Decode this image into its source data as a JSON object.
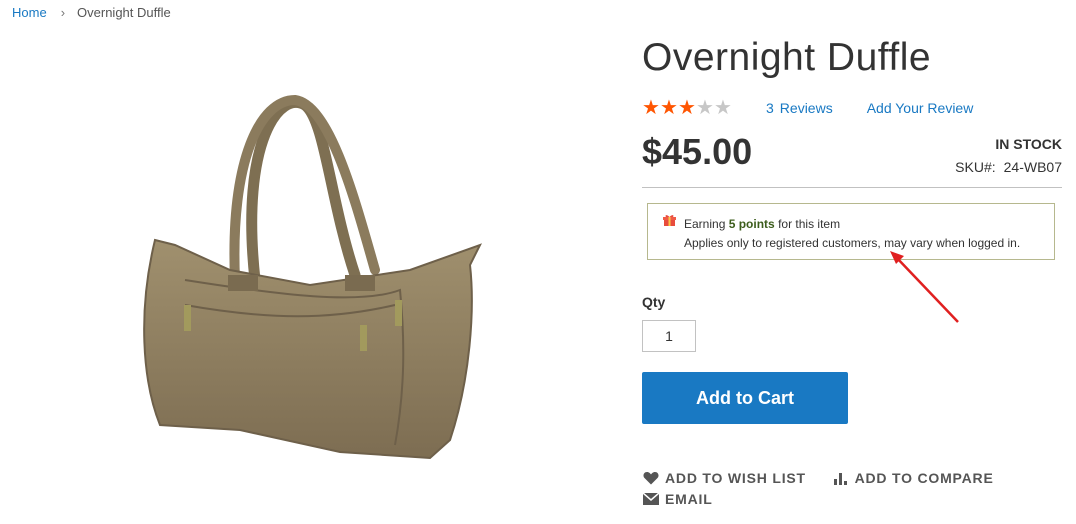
{
  "breadcrumb": {
    "home": "Home",
    "current": "Overnight Duffle"
  },
  "product": {
    "name": "Overnight Duffle",
    "rating_out_of_5": 3,
    "reviews_count": "3",
    "reviews_label": "Reviews",
    "add_review": "Add Your Review",
    "price": "$45.00",
    "stock": "IN STOCK",
    "sku_label": "SKU#:",
    "sku": "24-WB07"
  },
  "reward": {
    "prefix": "Earning",
    "points": "5 points",
    "suffix": "for this item",
    "note": "Applies only to registered customers, may vary when logged in."
  },
  "form": {
    "qty_label": "Qty",
    "qty_value": "1",
    "add_to_cart": "Add to Cart"
  },
  "actions": {
    "wishlist": "ADD TO WISH LIST",
    "compare": "ADD TO COMPARE",
    "email": "EMAIL"
  },
  "colors": {
    "accent": "#1979c3",
    "star": "#ff5501",
    "annotation": "#e02020"
  }
}
